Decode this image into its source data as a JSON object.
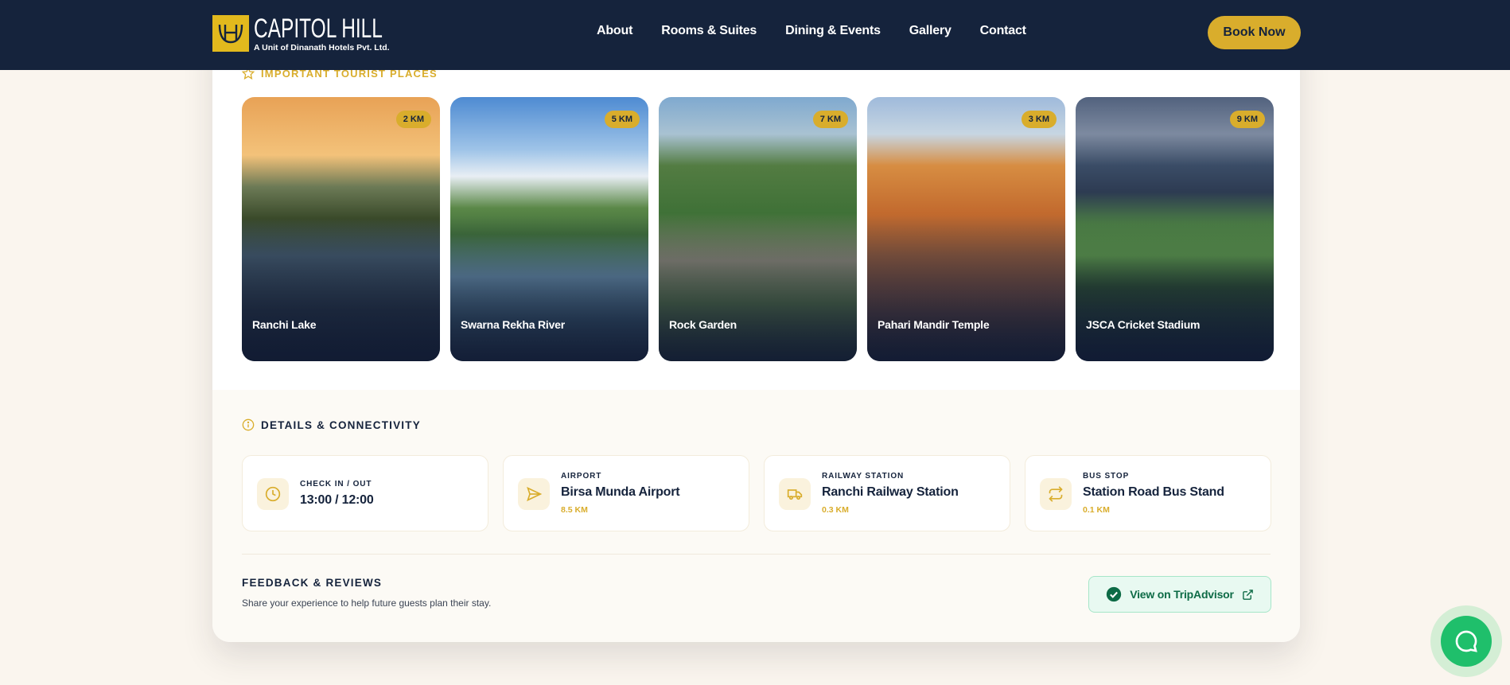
{
  "header": {
    "logo_title": "CAPITOL HILL",
    "logo_subtitle": "A Unit of Dinanath Hotels Pvt. Ltd.",
    "nav": [
      "About",
      "Rooms & Suites",
      "Dining & Events",
      "Gallery",
      "Contact"
    ],
    "book_label": "Book Now"
  },
  "tourist": {
    "heading": "IMPORTANT TOURIST PLACES",
    "places": [
      {
        "name": "Ranchi Lake",
        "distance": "2 KM"
      },
      {
        "name": "Swarna Rekha River",
        "distance": "5 KM"
      },
      {
        "name": "Rock Garden",
        "distance": "7 KM"
      },
      {
        "name": "Pahari Mandir Temple",
        "distance": "3 KM"
      },
      {
        "name": "JSCA Cricket Stadium",
        "distance": "9 KM"
      }
    ]
  },
  "details": {
    "heading": "DETAILS & CONNECTIVITY",
    "items": [
      {
        "label": "CHECK IN / OUT",
        "value": "13:00 / 12:00",
        "sub": "",
        "icon": "clock-icon"
      },
      {
        "label": "AIRPORT",
        "value": "Birsa Munda Airport",
        "sub": "8.5 KM",
        "icon": "send-icon"
      },
      {
        "label": "RAILWAY STATION",
        "value": "Ranchi Railway Station",
        "sub": "0.3 KM",
        "icon": "truck-icon"
      },
      {
        "label": "BUS STOP",
        "value": "Station Road Bus Stand",
        "sub": "0.1 KM",
        "icon": "repeat-icon"
      }
    ]
  },
  "feedback": {
    "title": "FEEDBACK & REVIEWS",
    "subtitle": "Share your experience to help future guests plan their stay.",
    "button_label": "View on TripAdvisor"
  },
  "colors": {
    "navy": "#15233c",
    "gold": "#d9ad2c",
    "green": "#1fbf6b"
  }
}
